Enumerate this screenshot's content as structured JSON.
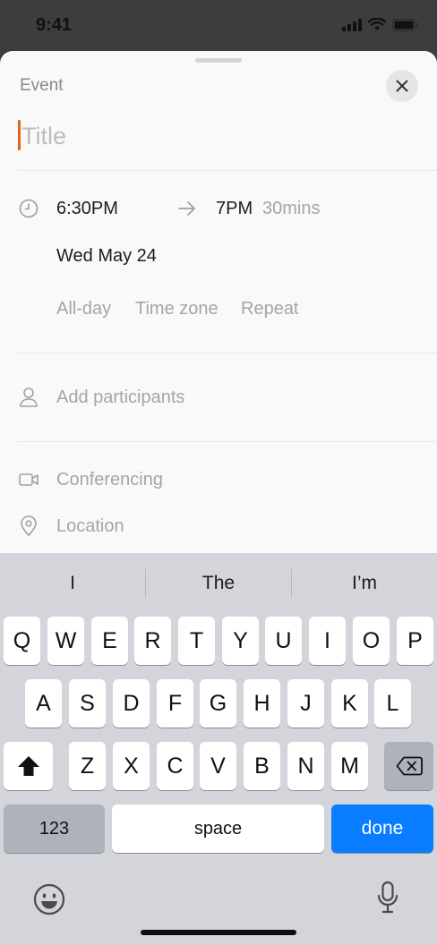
{
  "status_bar": {
    "time": "9:41"
  },
  "sheet": {
    "header": "Event",
    "title_placeholder": "Title",
    "start_time": "6:30PM",
    "end_time": "7PM",
    "duration": "30mins",
    "date": "Wed May 24",
    "options": [
      "All-day",
      "Time zone",
      "Repeat"
    ],
    "participants_placeholder": "Add participants",
    "conferencing_label": "Conferencing",
    "location_label": "Location"
  },
  "keyboard": {
    "suggestions": [
      "I",
      "The",
      "I’m"
    ],
    "row1": [
      "Q",
      "W",
      "E",
      "R",
      "T",
      "Y",
      "U",
      "I",
      "O",
      "P"
    ],
    "row2": [
      "A",
      "S",
      "D",
      "F",
      "G",
      "H",
      "J",
      "K",
      "L"
    ],
    "row3": [
      "Z",
      "X",
      "C",
      "V",
      "B",
      "N",
      "M"
    ],
    "numbers_key": "123",
    "space_key": "space",
    "done_key": "done"
  },
  "colors": {
    "caret": "#e3651d",
    "done_key": "#0a7cff",
    "keyboard_bg": "#d3d5db"
  }
}
